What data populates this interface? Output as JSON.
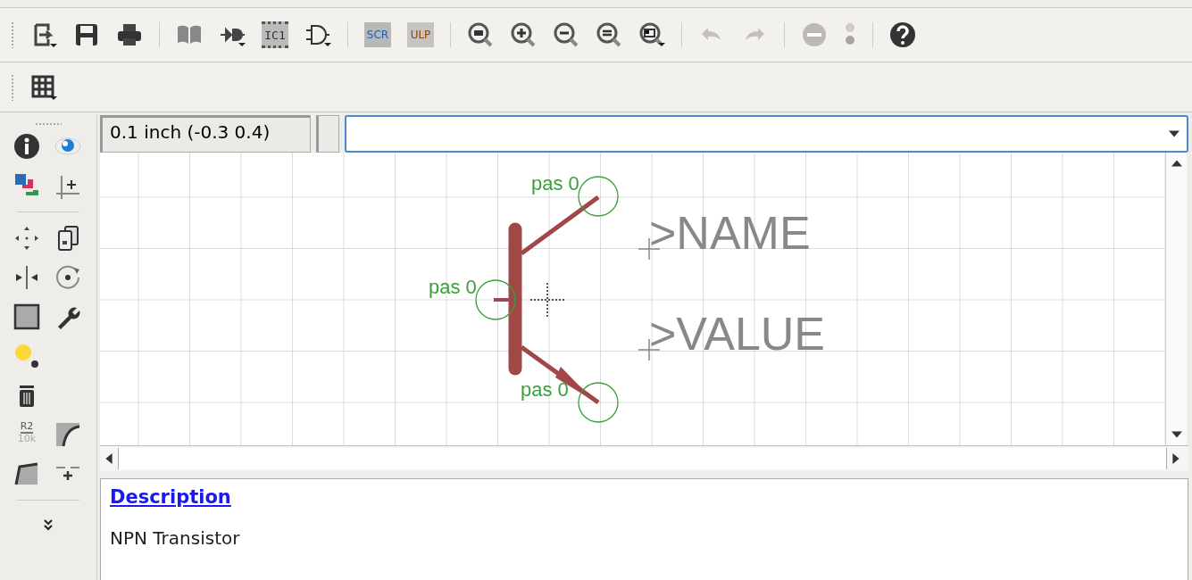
{
  "toolbar": {
    "device_label": "IC1",
    "script_label": "SCR",
    "ulp_label": "ULP",
    "undo": {
      "disabled": true
    },
    "redo": {
      "disabled": true
    },
    "stop": {
      "disabled": true
    },
    "go": {
      "disabled": true
    }
  },
  "command_bar": {
    "coordinates": "0.1 inch (-0.3 0.4)"
  },
  "side_toolbar": {
    "value_icon": {
      "name": "R2",
      "value": "10k"
    }
  },
  "canvas": {
    "pins": [
      {
        "label": "pas 0"
      },
      {
        "label": "pas 0"
      },
      {
        "label": "pas 0"
      }
    ],
    "texts": [
      ">NAME",
      ">VALUE"
    ]
  },
  "description": {
    "heading": "Description",
    "text": "NPN Transistor"
  }
}
